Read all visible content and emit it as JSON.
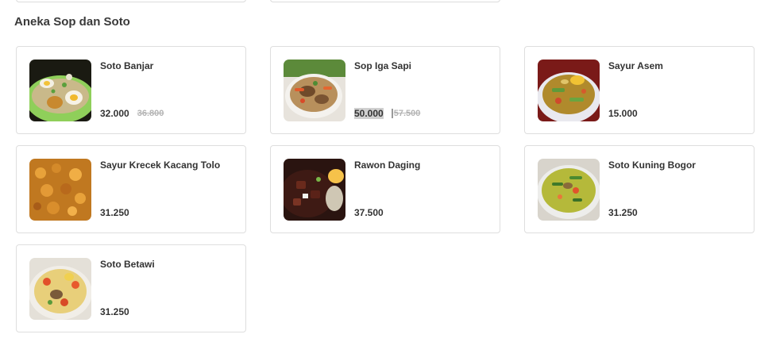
{
  "section": {
    "title": "Aneka Sop dan Soto"
  },
  "items": [
    {
      "name": "Soto Banjar",
      "price": "32.000",
      "old_price": "36.800",
      "image_icon": "soto-banjar-photo"
    },
    {
      "name": "Sop Iga Sapi",
      "price": "50.000",
      "old_price": "57.500",
      "image_icon": "sop-iga-sapi-photo"
    },
    {
      "name": "Sayur Asem",
      "price": "15.000",
      "old_price": "",
      "image_icon": "sayur-asem-photo"
    },
    {
      "name": "Sayur Krecek Kacang Tolo",
      "price": "31.250",
      "old_price": "",
      "image_icon": "sayur-krecek-photo"
    },
    {
      "name": "Rawon Daging",
      "price": "37.500",
      "old_price": "",
      "image_icon": "rawon-daging-photo"
    },
    {
      "name": "Soto Kuning Bogor",
      "price": "31.250",
      "old_price": "",
      "image_icon": "soto-kuning-bogor-photo"
    },
    {
      "name": "Soto Betawi",
      "price": "31.250",
      "old_price": "",
      "image_icon": "soto-betawi-photo"
    }
  ]
}
